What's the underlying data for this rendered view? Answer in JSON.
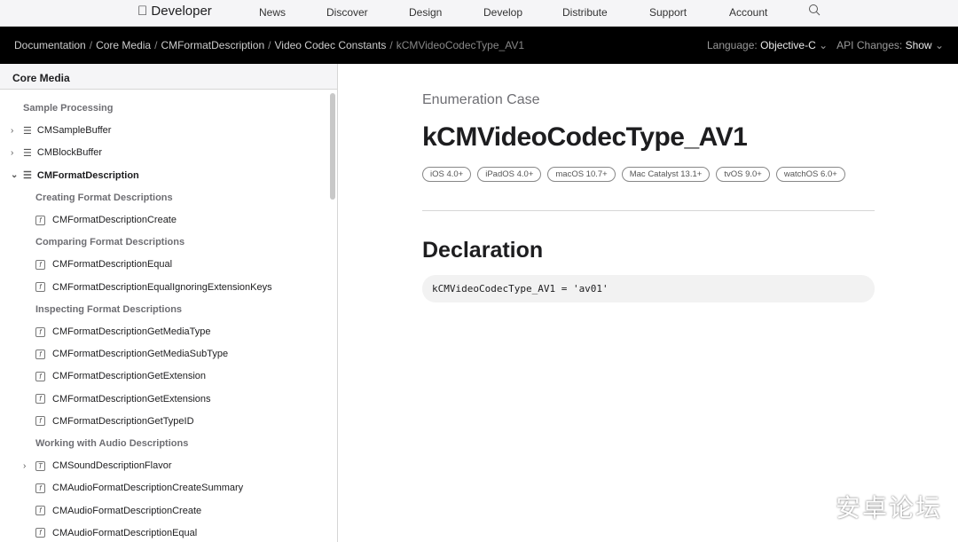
{
  "nav": {
    "logo": "Developer",
    "items": [
      "News",
      "Discover",
      "Design",
      "Develop",
      "Distribute",
      "Support",
      "Account"
    ]
  },
  "breadcrumb": [
    "Documentation",
    "Core Media",
    "CMFormatDescription",
    "Video Codec Constants",
    "kCMVideoCodecType_AV1"
  ],
  "options": {
    "language_label": "Language:",
    "language": "Objective-C",
    "api_label": "API Changes:",
    "api": "Show"
  },
  "sidebar": {
    "title": "Core Media",
    "items": [
      {
        "label": "Sample Processing",
        "type": "header",
        "level": 0
      },
      {
        "label": "CMSampleBuffer",
        "type": "list",
        "level": 0,
        "chevron": "right"
      },
      {
        "label": "CMBlockBuffer",
        "type": "list",
        "level": 0,
        "chevron": "right"
      },
      {
        "label": "CMFormatDescription",
        "type": "list",
        "level": 0,
        "chevron": "down",
        "bold": true
      },
      {
        "label": "Creating Format Descriptions",
        "type": "header",
        "level": 1
      },
      {
        "label": "CMFormatDescriptionCreate",
        "type": "func",
        "level": 1
      },
      {
        "label": "Comparing Format Descriptions",
        "type": "header",
        "level": 1
      },
      {
        "label": "CMFormatDescriptionEqual",
        "type": "func",
        "level": 1
      },
      {
        "label": "CMFormatDescriptionEqualIgnoringExtensionKeys",
        "type": "func",
        "level": 1
      },
      {
        "label": "Inspecting Format Descriptions",
        "type": "header",
        "level": 1
      },
      {
        "label": "CMFormatDescriptionGetMediaType",
        "type": "func",
        "level": 1
      },
      {
        "label": "CMFormatDescriptionGetMediaSubType",
        "type": "func",
        "level": 1
      },
      {
        "label": "CMFormatDescriptionGetExtension",
        "type": "func",
        "level": 1
      },
      {
        "label": "CMFormatDescriptionGetExtensions",
        "type": "func",
        "level": 1
      },
      {
        "label": "CMFormatDescriptionGetTypeID",
        "type": "func",
        "level": 1
      },
      {
        "label": "Working with Audio Descriptions",
        "type": "header",
        "level": 1
      },
      {
        "label": "CMSoundDescriptionFlavor",
        "type": "type",
        "level": 1,
        "chevron": "right"
      },
      {
        "label": "CMAudioFormatDescriptionCreateSummary",
        "type": "func",
        "level": 1
      },
      {
        "label": "CMAudioFormatDescriptionCreate",
        "type": "func",
        "level": 1
      },
      {
        "label": "CMAudioFormatDescriptionEqual",
        "type": "func",
        "level": 1
      }
    ]
  },
  "main": {
    "eyebrow": "Enumeration Case",
    "title": "kCMVideoCodecType_AV1",
    "platforms": [
      "iOS 4.0+",
      "iPadOS 4.0+",
      "macOS 10.7+",
      "Mac Catalyst 13.1+",
      "tvOS 9.0+",
      "watchOS 6.0+"
    ],
    "declaration_heading": "Declaration",
    "declaration": "kCMVideoCodecType_AV1 = 'av01'"
  },
  "watermark": "安卓论坛"
}
